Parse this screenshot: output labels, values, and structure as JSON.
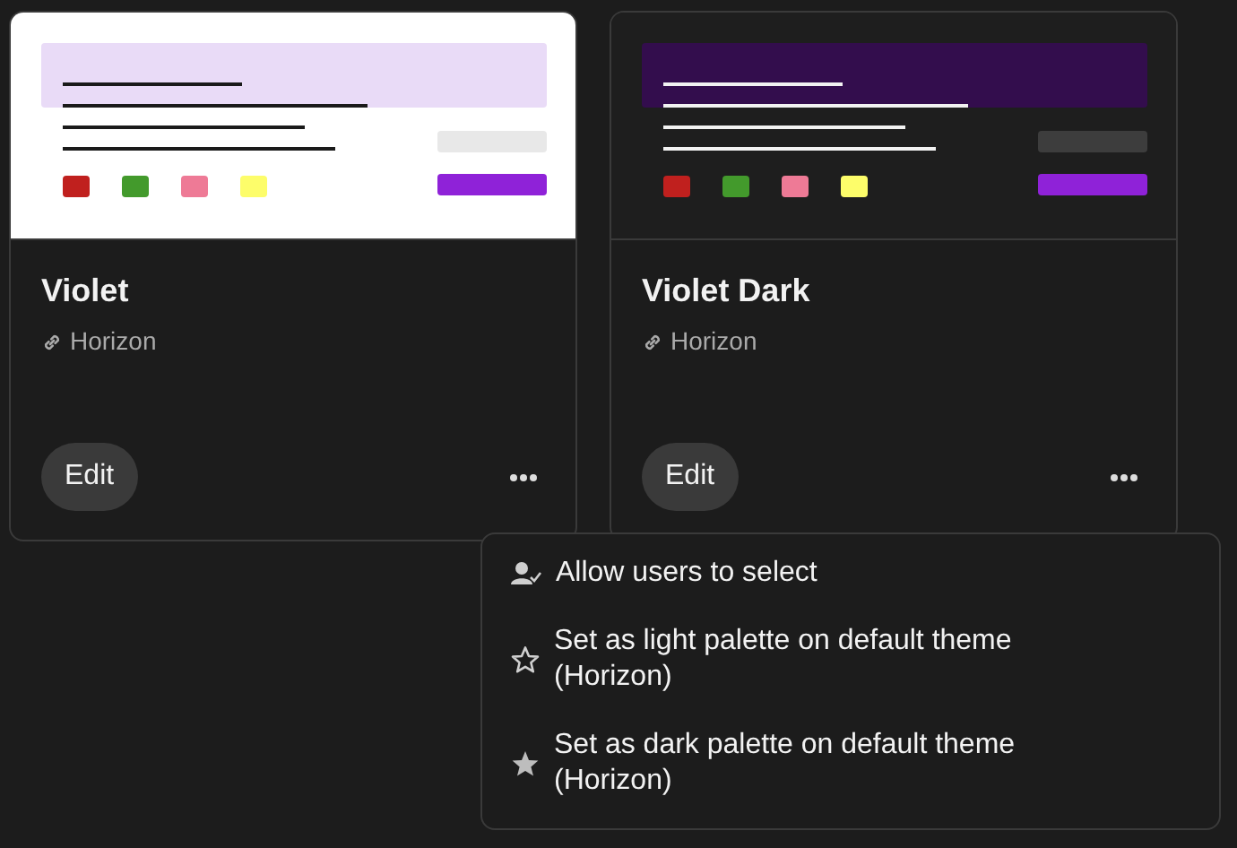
{
  "cards": [
    {
      "title": "Violet",
      "theme": "Horizon",
      "dark": false,
      "edit_label": "Edit",
      "swatches": [
        {
          "color": "#c0201e"
        },
        {
          "color": "#439a2c"
        },
        {
          "color": "#ee7a96"
        },
        {
          "color": "#fdfd6a"
        }
      ]
    },
    {
      "title": "Violet Dark",
      "theme": "Horizon",
      "dark": true,
      "edit_label": "Edit",
      "swatches": [
        {
          "color": "#c0201e"
        },
        {
          "color": "#439a2c"
        },
        {
          "color": "#ee7a96"
        },
        {
          "color": "#fdfd6a"
        }
      ]
    }
  ],
  "menu": {
    "items": [
      {
        "kind": "user-check",
        "label": "Allow users to select"
      },
      {
        "kind": "star-outline",
        "label": "Set as light palette on default theme (Horizon)"
      },
      {
        "kind": "star-filled",
        "label": "Set as dark palette on default theme (Horizon)"
      }
    ]
  }
}
